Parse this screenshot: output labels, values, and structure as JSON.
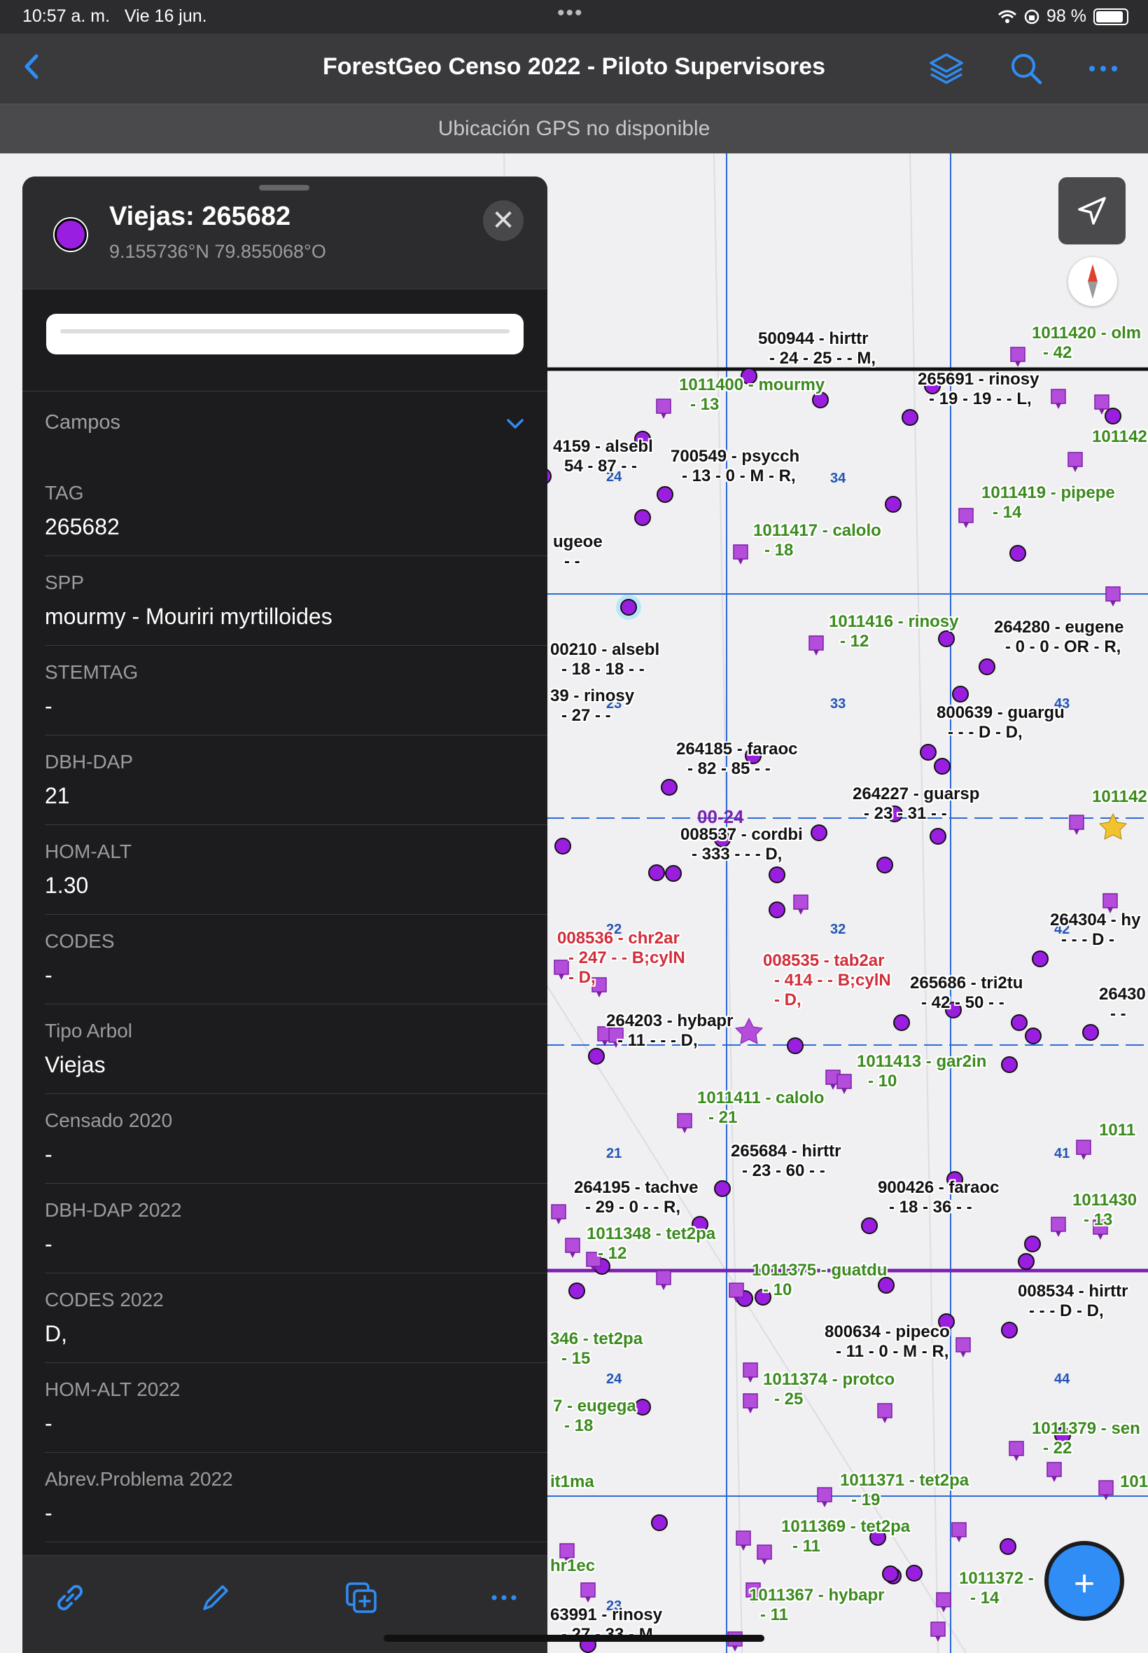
{
  "status_bar": {
    "time": "10:57 a. m.",
    "date": "Vie 16 jun.",
    "battery": "98 %"
  },
  "navbar": {
    "title": "ForestGeo Censo 2022 - Piloto Supervisores"
  },
  "gps_banner": "Ubicación GPS no disponible",
  "colors": {
    "point": "#9a1ee0",
    "accent": "#2f8df5",
    "grid": "#2d6ad6"
  },
  "panel": {
    "title": "Viejas: 265682",
    "coords": "9.155736°N  79.855068°O",
    "section_label": "Campos",
    "fields": [
      {
        "key": "TAG",
        "value": "265682"
      },
      {
        "key": "SPP",
        "value": "mourmy - Mouriri myrtilloides"
      },
      {
        "key": "STEMTAG",
        "value": "-"
      },
      {
        "key": "DBH-DAP",
        "value": "21"
      },
      {
        "key": "HOM-ALT",
        "value": "1.30"
      },
      {
        "key": "CODES",
        "value": "-"
      },
      {
        "key": "Tipo Arbol",
        "value": "Viejas"
      },
      {
        "key": "Censado 2020",
        "value": "-"
      },
      {
        "key": "DBH-DAP 2022",
        "value": "-"
      },
      {
        "key": "CODES 2022",
        "value": "D,"
      },
      {
        "key": "HOM-ALT 2022",
        "value": "-"
      },
      {
        "key": "Abrev.Problema 2022",
        "value": "-"
      },
      {
        "key": "Explicación Problema",
        "value": ""
      }
    ]
  },
  "map": {
    "quadrat_label": "00-24",
    "grid_numbers": [
      "24",
      "34",
      "23",
      "33",
      "43",
      "22",
      "32",
      "42",
      "21",
      "41",
      "24",
      "44",
      "23"
    ],
    "labels": [
      {
        "l1": "500944 - hirttr",
        "l2": "- 24 - 25 - - M,",
        "c": "black"
      },
      {
        "l1": "1011420 - olm",
        "l2": "- 42",
        "c": "green"
      },
      {
        "l1": "1011400 - mourmy",
        "l2": "- 13",
        "c": "green"
      },
      {
        "l1": "265691 - rinosy",
        "l2": "- 19 - 19 - - L,",
        "c": "black"
      },
      {
        "l1": "4159 - alsebl",
        "l2": "54 - 87 - -",
        "c": "black"
      },
      {
        "l1": "700549 - psycch",
        "l2": "- 13 - 0 - M - R,",
        "c": "black"
      },
      {
        "l1": "101142",
        "l2": "",
        "c": "green"
      },
      {
        "l1": "1011419 - pipepe",
        "l2": "- 14",
        "c": "green"
      },
      {
        "l1": "1011417 - calolo",
        "l2": "- 18",
        "c": "green"
      },
      {
        "l1": "ugeoe",
        "l2": "- -",
        "c": "black"
      },
      {
        "l1": "1011416 - rinosy",
        "l2": "- 12",
        "c": "green"
      },
      {
        "l1": "264280 - eugene",
        "l2": "- 0 - 0 - OR - R,",
        "c": "black"
      },
      {
        "l1": "00210 - alsebl",
        "l2": "- 18 - 18 - -",
        "c": "black"
      },
      {
        "l1": "39 - rinosy",
        "l2": "- 27 - -",
        "c": "black"
      },
      {
        "l1": "800639 - guargu",
        "l2": "- - - D - D,",
        "c": "black"
      },
      {
        "l1": "264185 - faraoc",
        "l2": "- 82 - 85 - -",
        "c": "black"
      },
      {
        "l1": "264227 - guarsp",
        "l2": "- 23 - 31 - -",
        "c": "black"
      },
      {
        "l1": "101142",
        "l2": "",
        "c": "green"
      },
      {
        "l1": "008537 - cordbi",
        "l2": "- 333 - - - D,",
        "c": "black"
      },
      {
        "l1": "264304 - hy",
        "l2": "- - - D -",
        "c": "black"
      },
      {
        "l1": "008536 - chr2ar",
        "l2": "- 247 - - B;cylN",
        "l3": "- D,",
        "c": "red"
      },
      {
        "l1": "008535 - tab2ar",
        "l2": "- 414 - - B;cylN",
        "l3": "- D,",
        "c": "red"
      },
      {
        "l1": "265686 - tri2tu",
        "l2": "- 42 - 50 - -",
        "c": "black"
      },
      {
        "l1": "26430",
        "l2": "- -",
        "c": "black"
      },
      {
        "l1": "264203 - hybapr",
        "l2": "- 11 - - - D,",
        "c": "black"
      },
      {
        "l1": "1011413 - gar2in",
        "l2": "- 10",
        "c": "green"
      },
      {
        "l1": "1011411 - calolo",
        "l2": "- 21",
        "c": "green"
      },
      {
        "l1": "1011",
        "l2": "",
        "c": "green"
      },
      {
        "l1": "265684 - hirttr",
        "l2": "- 23 - 60 - -",
        "c": "black"
      },
      {
        "l1": "264195 - tachve",
        "l2": "- 29 - 0 - - R,",
        "c": "black"
      },
      {
        "l1": "900426 - faraoc",
        "l2": "- 18 - 36 - -",
        "c": "black"
      },
      {
        "l1": "1011430",
        "l2": "- 13",
        "c": "green"
      },
      {
        "l1": "1011348 - tet2pa",
        "l2": "- 12",
        "c": "green"
      },
      {
        "l1": "1011375 - guatdu",
        "l2": "- 10",
        "c": "green"
      },
      {
        "l1": "008534 - hirttr",
        "l2": "- - - D - D,",
        "c": "black"
      },
      {
        "l1": "800634 - pipeco",
        "l2": "- 11 - 0 - M - R,",
        "c": "black"
      },
      {
        "l1": "346 - tet2pa",
        "l2": "- 15",
        "c": "green"
      },
      {
        "l1": "1011374 - protco",
        "l2": "- 25",
        "c": "green"
      },
      {
        "l1": "7 - eugega",
        "l2": "- 18",
        "c": "green"
      },
      {
        "l1": "1011379 - sen",
        "l2": "- 22",
        "c": "green"
      },
      {
        "l1": "it1ma",
        "l2": "",
        "c": "green"
      },
      {
        "l1": "1011371 - tet2pa",
        "l2": "- 19",
        "c": "green"
      },
      {
        "l1": "101",
        "l2": "",
        "c": "green"
      },
      {
        "l1": "1011369 - tet2pa",
        "l2": "- 11",
        "c": "green"
      },
      {
        "l1": "hr1ec",
        "l2": "",
        "c": "green"
      },
      {
        "l1": "1011372 -",
        "l2": "- 14",
        "c": "green"
      },
      {
        "l1": "1011367 - hybapr",
        "l2": "- 11",
        "c": "green"
      },
      {
        "l1": "63991 - rinosy",
        "l2": "- 27 - 33 - M",
        "c": "black"
      }
    ]
  },
  "icons": {
    "back": "chevron-left-icon",
    "layers": "layers-icon",
    "search": "search-icon",
    "more": "ellipsis-icon",
    "link": "link-icon",
    "edit": "pencil-icon",
    "duplicate": "duplicate-icon",
    "add": "plus-icon"
  }
}
